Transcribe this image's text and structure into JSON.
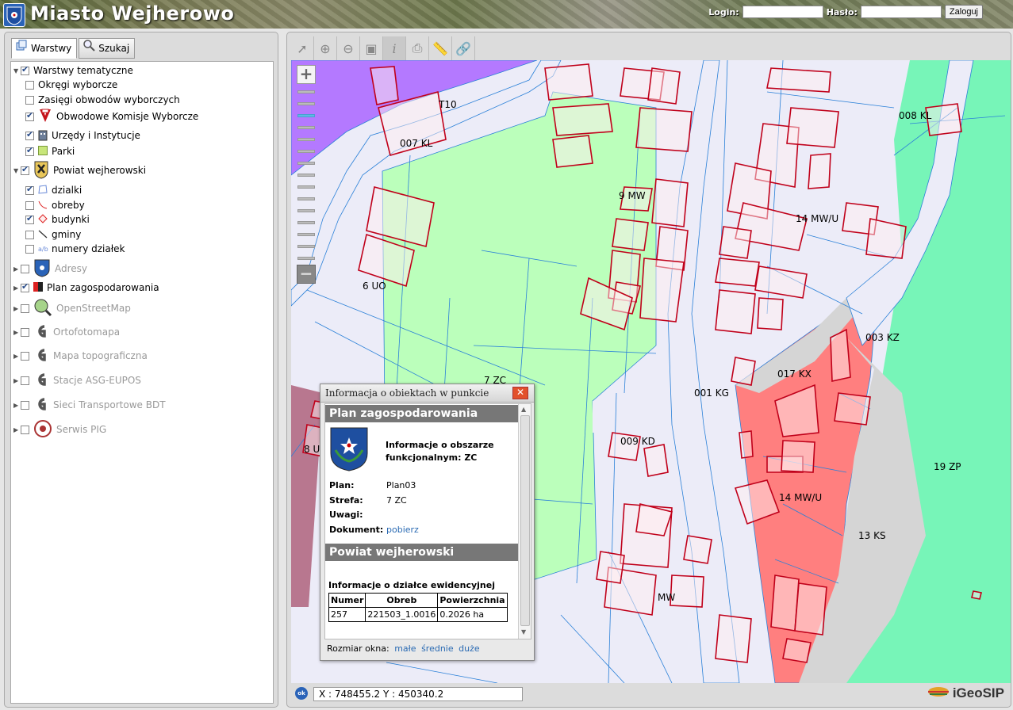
{
  "header": {
    "title": "Miasto Wejherowo",
    "login_label": "Login:",
    "password_label": "Hasło:",
    "login_button": "Zaloguj",
    "login_value": "",
    "password_value": ""
  },
  "left_panel": {
    "tabs": [
      {
        "label": "Warstwy",
        "icon": "layers-icon",
        "active": true
      },
      {
        "label": "Szukaj",
        "icon": "magnifier-icon",
        "active": false
      }
    ],
    "tree": [
      {
        "label": "Warstwy tematyczne",
        "checked": true,
        "expanded": true
      },
      {
        "label": "Okręgi wyborcze",
        "checked": false
      },
      {
        "label": "Zasięgi obwodów wyborczych",
        "checked": false
      },
      {
        "label": "Obwodowe Komisje Wyborcze",
        "checked": true,
        "icon": "voting-icon"
      },
      {
        "label": "Urzędy i Instytucje",
        "checked": true,
        "icon": "institution-icon"
      },
      {
        "label": "Parki",
        "checked": true,
        "icon": "park-icon"
      },
      {
        "label": "Powiat wejherowski",
        "checked": true,
        "expanded": true,
        "icon": "county-crest-icon"
      },
      {
        "label": "dzialki",
        "checked": true,
        "icon": "parcel-icon"
      },
      {
        "label": "obreby",
        "checked": false,
        "icon": "precinct-line-icon"
      },
      {
        "label": "budynki",
        "checked": true,
        "icon": "building-icon"
      },
      {
        "label": "gminy",
        "checked": false,
        "icon": "commune-line-icon"
      },
      {
        "label": "numery działek",
        "checked": false,
        "icon": "parcel-number-icon"
      },
      {
        "label": "Adresy",
        "checked": false,
        "icon": "address-crest-icon",
        "disabled": true
      },
      {
        "label": "Plan zagospodarowania",
        "checked": true,
        "icon": "zoning-plan-icon"
      },
      {
        "label": "OpenStreetMap",
        "checked": false,
        "icon": "osm-icon",
        "disabled": true
      },
      {
        "label": "Ortofotomapa",
        "checked": false,
        "icon": "wms-icon",
        "disabled": true
      },
      {
        "label": "Mapa topograficzna",
        "checked": false,
        "icon": "wms-icon",
        "disabled": true
      },
      {
        "label": "Stacje ASG-EUPOS",
        "checked": false,
        "icon": "wms-icon",
        "disabled": true
      },
      {
        "label": "Sieci Transportowe BDT",
        "checked": false,
        "icon": "wms-icon",
        "disabled": true
      },
      {
        "label": "Serwis PIG",
        "checked": false,
        "icon": "pig-icon",
        "disabled": true
      }
    ]
  },
  "map": {
    "labels": [
      "T10",
      "007 KL",
      "008 KL",
      "9 MW",
      "14 MW/U",
      "6 UO",
      "7 ZC",
      "001 KG",
      "017 KX",
      "003 KZ",
      "8 U",
      "009 KD",
      "19 ZP",
      "14 MW/U",
      "13 KS",
      "MW"
    ],
    "coords": "X : 748455.2  Y : 450340.2",
    "brand": "iGeoSIP",
    "ok_label": "ok"
  },
  "popup": {
    "title": "Informacja o obiektach w punkcie",
    "section1": "Plan zagospodarowania",
    "area_info": "Informacje o obszarze funkcjonalnym: ZC",
    "fields": [
      {
        "key": "Plan:",
        "value": "Plan03"
      },
      {
        "key": "Strefa:",
        "value": "7 ZC"
      },
      {
        "key": "Uwagi:",
        "value": ""
      },
      {
        "key": "Dokument:",
        "value": "pobierz"
      }
    ],
    "section2": "Powiat wejherowski",
    "parcel_heading": "Informacje o działce ewidencyjnej",
    "table": {
      "headers": [
        "Numer",
        "Obreb",
        "Powierzchnia"
      ],
      "rows": [
        [
          "257",
          "221503_1.0016",
          "0.2026 ha"
        ]
      ]
    },
    "size_label": "Rozmiar okna:",
    "size_options": [
      "małe",
      "średnie",
      "duże"
    ]
  },
  "colors": {
    "zone_purple": "#b479ff",
    "zone_green": "#bbffbb",
    "zone_red": "#ff7f7f",
    "zone_mint": "#77f5b8",
    "zone_mauve": "#b8778f",
    "building_outline": "#c0001a",
    "boundary_blue": "#2a80d8"
  }
}
